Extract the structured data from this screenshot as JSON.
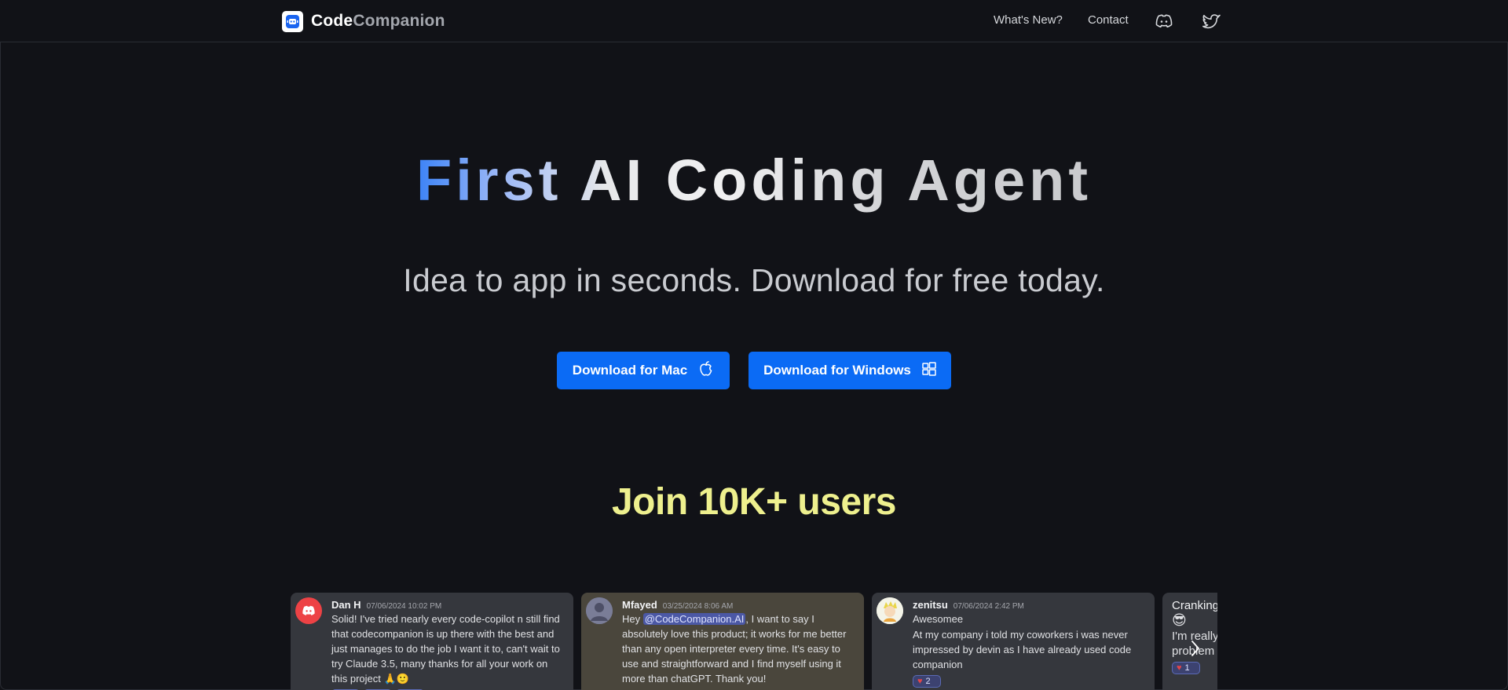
{
  "nav": {
    "brand_part1": "Code",
    "brand_part2": "Companion",
    "links": [
      {
        "label": "What's New?"
      },
      {
        "label": "Contact"
      }
    ],
    "icons": [
      "discord-icon",
      "twitter-icon"
    ]
  },
  "hero": {
    "title": "First AI Coding Agent",
    "subtitle": "Idea to app in seconds. Download for free today.",
    "buttons": {
      "mac": "Download for Mac",
      "windows": "Download for Windows"
    }
  },
  "social": {
    "heading": "Join 10K+ users",
    "testimonials": [
      {
        "name": "Dan H",
        "time": "07/06/2024 10:02 PM",
        "body": "Solid! I've tried nearly every code-copilot n still find that codecompanion is up there with the best and just manages to do the job I want it to, can't wait to try Claude 3.5, many thanks for all your work on this project 🙏🙂"
      },
      {
        "name": "Mfayed",
        "time": "03/25/2024 8:06 AM",
        "body_pre": "Hey ",
        "mention": "@CodeCompanion.AI",
        "body_post": ", I want to say I absolutely love this product; it works for me better than any open interpreter every time. It's easy to use and straightforward and I find myself using it more than chatGPT. Thank you!"
      },
      {
        "name": "zenitsu",
        "time": "07/06/2024 2:42 PM",
        "line1": "Awesomee",
        "body": "At my company i told my coworkers i was never impressed by devin as I have already used code companion",
        "reaction": "2"
      },
      {
        "name": "Cranking",
        "line1": "😎",
        "body": "I'm really problem",
        "reaction": "1"
      }
    ]
  },
  "colors": {
    "background": "#111217",
    "button": "#0b6bf5",
    "heading_accent": "#eef08e",
    "title_gradient_start": "#3b82f6"
  }
}
